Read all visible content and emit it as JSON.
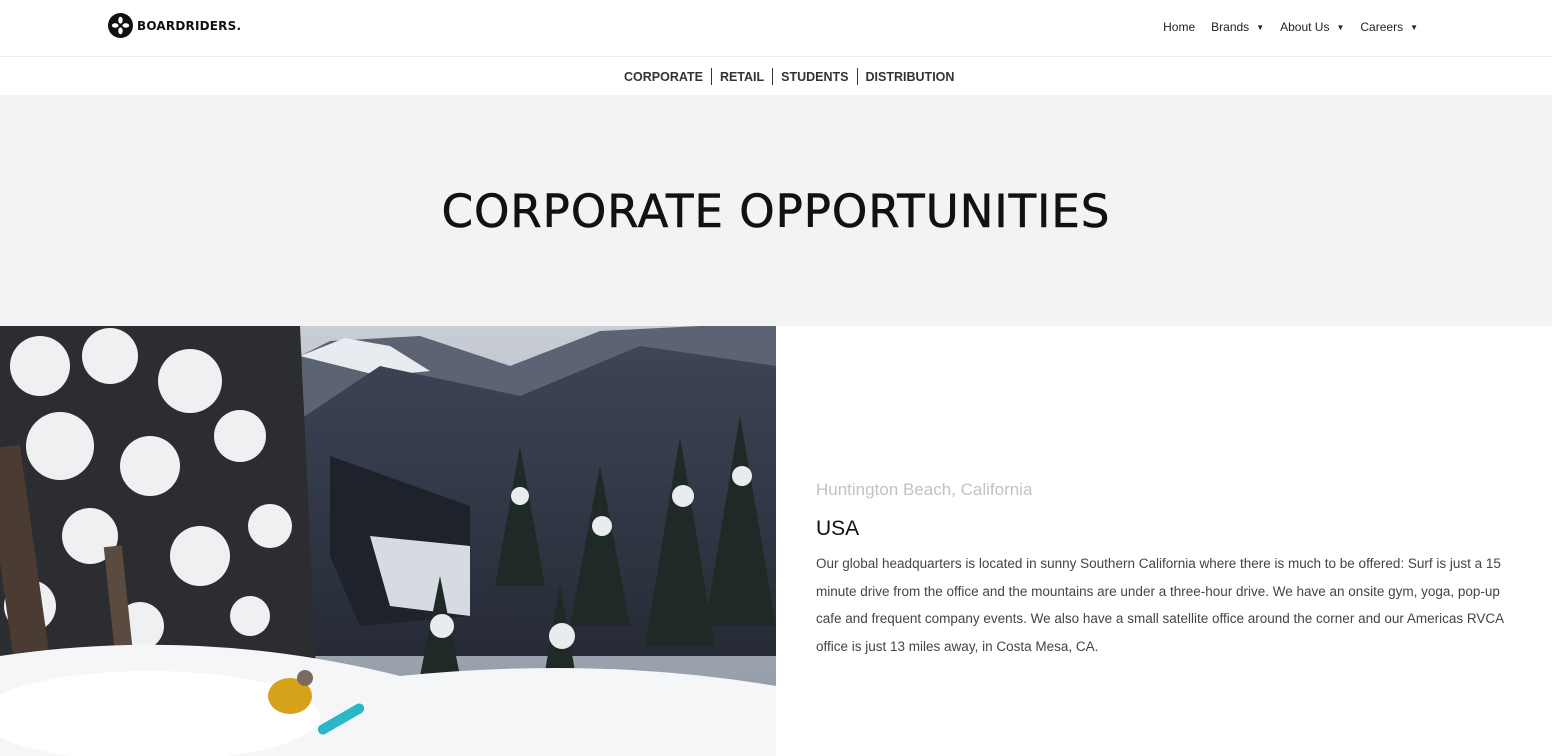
{
  "header": {
    "logo_text": "BOARDRIDERS.",
    "nav": [
      {
        "label": "Home",
        "has_dropdown": false
      },
      {
        "label": "Brands",
        "has_dropdown": true
      },
      {
        "label": "About Us",
        "has_dropdown": true
      },
      {
        "label": "Careers",
        "has_dropdown": true
      }
    ]
  },
  "subnav": {
    "links": [
      "CORPORATE",
      "RETAIL",
      "STUDENTS",
      "DISTRIBUTION"
    ]
  },
  "hero": {
    "title": "CORPORATE OPPORTUNITIES"
  },
  "location": {
    "city": "Huntington Beach, California",
    "country": "USA",
    "description": "Our global headquarters is located in sunny Southern California where there is much to be offered: Surf is just a 15 minute drive from the office and the mountains are under a three-hour drive. We have an onsite gym, yoga, pop-up cafe and frequent company events. We also have a small satellite office around the corner and our Americas RVCA office is just 13 miles away, in Costa Mesa, CA."
  },
  "icons": {
    "logo": "boardriders-logo-icon",
    "dropdown": "caret-down-icon",
    "scroll_top": "arrow-up-to-line-icon"
  },
  "colors": {
    "hero_bg": "#f3f3f3",
    "text_dark": "#111111",
    "text_light": "#c2c2c2"
  }
}
